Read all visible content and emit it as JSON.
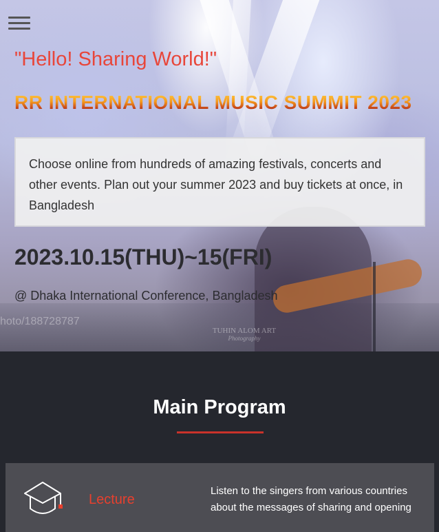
{
  "nav": {
    "menu_icon": "hamburger-menu-icon"
  },
  "hero": {
    "greeting": "\"Hello! Sharing World!\"",
    "title": "RR INTERNATIONAL MUSIC SUMMIT 2023",
    "intro": "Choose online from hundreds of amazing festivals, concerts and other events. Plan out your summer 2023 and buy tickets at once, in Bangladesh",
    "date": "2023.10.15(THU)~15(FRI)",
    "venue": "@ Dhaka International Conference, Bangladesh",
    "photo_watermark_left": "hoto/188728787",
    "photo_watermark_name": "TUHIN ALOM ART",
    "photo_watermark_sub": "Photography"
  },
  "program": {
    "title": "Main Program",
    "accent_color": "#c9322a",
    "cards": [
      {
        "icon": "graduation-cap-icon",
        "label": "Lecture",
        "description": "Listen to the singers from various countries about the messages of sharing and opening"
      }
    ]
  },
  "colors": {
    "greeting": "#e8463a",
    "dark_section": "#25272e",
    "card_bg": "#4d4d53",
    "card_label": "#e8402e"
  }
}
